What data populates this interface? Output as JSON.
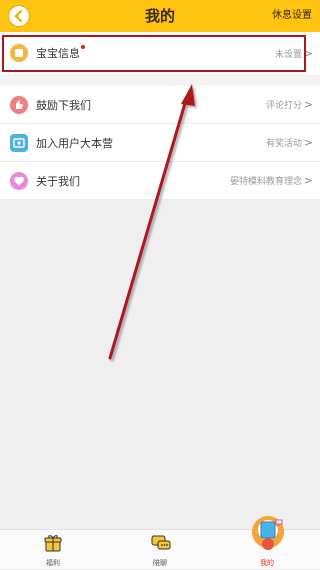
{
  "header": {
    "title": "我的",
    "right_link": "休息设置"
  },
  "menu": {
    "items": [
      {
        "label": "宝宝信息",
        "value": "未设置",
        "icon": "baby-icon",
        "color": "#f3b73f"
      },
      {
        "label": "鼓励下我们",
        "value": "评论打分",
        "icon": "thumb-icon",
        "color": "#f07f7f"
      },
      {
        "label": "加入用户大本营",
        "value": "有奖活动",
        "icon": "camp-icon",
        "color": "#4cb2e6"
      },
      {
        "label": "关于我们",
        "value": "晏特模科教育理念",
        "icon": "heart-icon",
        "color": "#e88ad6"
      }
    ]
  },
  "tabbar": {
    "tabs": [
      {
        "label": "福利",
        "icon": "gift-icon"
      },
      {
        "label": "陪聊",
        "icon": "chat-icon"
      },
      {
        "label": "我的",
        "icon": "avatar-icon",
        "active": true
      }
    ]
  },
  "colors": {
    "header_bg": "#ffc312",
    "highlight": "#b0151a",
    "active_tab": "#e03030"
  }
}
